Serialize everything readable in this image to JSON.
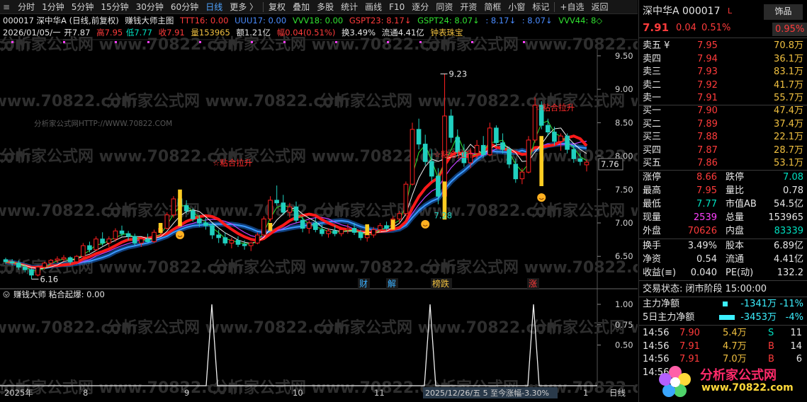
{
  "toolbar": {
    "items": [
      "分时",
      "1分钟",
      "5分钟",
      "15分钟",
      "30分钟",
      "60分钟",
      "日线",
      "更多 〉",
      "复权",
      "叠加",
      "多股",
      "统计",
      "画线",
      "F10",
      "逐分",
      "同资",
      "开资",
      "简框",
      "小窗",
      "标记",
      "+自选",
      "返回"
    ],
    "active_index": 6
  },
  "info1": {
    "stock": "000017  深中华A (日线,前复权)",
    "formula": "赚钱大师主图",
    "ttt": "TTT16: 0.00",
    "uuu": "UUU17: 0.00",
    "vvv18": "VVV18: 0.00",
    "gspt23": "GSPT23: 8.17↓",
    "gspt24": "GSPT24: 8.07↓",
    "v1": ": 8.17↓",
    "v2": ": 8.07↓",
    "vvv44": "VVV44: 8◇"
  },
  "info2": {
    "date": "2026/01/05/一",
    "open": "开7.87",
    "high": "高7.95",
    "low": "低7.77",
    "close": "收7.91",
    "vol": "量153965",
    "amount": "额1.21亿",
    "change": "幅0.04(0.51%)",
    "turnover": "换3.49%",
    "float": "流通4.41亿",
    "sector": "钟表珠宝"
  },
  "watermark": {
    "site": "分析家公式网 www.70822.com",
    "url_small": "分析家公式网HTTP://WWW.70822.COM"
  },
  "chart": {
    "price_ticks": [
      "9.50",
      "9.00",
      "8.50",
      "8.00",
      "7.50",
      "7.00",
      "6.50"
    ],
    "current_price": "7.76",
    "annotations": {
      "peak": "9.23",
      "low1": "6.16",
      "low2": "7.28",
      "signal": "☆粘合拉升"
    },
    "event_tags": [
      "财",
      "解",
      "榜跌",
      "涨"
    ],
    "sub_title": "赚钱大师  粘合起爆: 0.00",
    "sub_ticks": [
      "1.00",
      "0.75",
      "0.50"
    ],
    "x_labels": [
      "2025年",
      "8",
      "9",
      "10",
      "11",
      "1"
    ],
    "cursor_label": "2025/12/26/五 5 至今涨幅-3.30%",
    "period": "日线"
  },
  "chart_data": [
    {
      "type": "candlestick",
      "title": "赚钱大师主图",
      "ylim": [
        6.1,
        9.7
      ],
      "candles": [
        [
          6.45,
          6.48,
          6.38,
          6.42
        ],
        [
          6.42,
          6.46,
          6.36,
          6.4
        ],
        [
          6.4,
          6.44,
          6.3,
          6.34
        ],
        [
          6.34,
          6.38,
          6.26,
          6.3
        ],
        [
          6.3,
          6.33,
          6.16,
          6.22
        ],
        [
          6.22,
          6.36,
          6.2,
          6.34
        ],
        [
          6.34,
          6.42,
          6.3,
          6.4
        ],
        [
          6.4,
          6.46,
          6.36,
          6.44
        ],
        [
          6.44,
          6.5,
          6.4,
          6.46
        ],
        [
          6.46,
          6.52,
          6.42,
          6.48
        ],
        [
          6.48,
          6.5,
          6.38,
          6.42
        ],
        [
          6.42,
          6.52,
          6.4,
          6.5
        ],
        [
          6.5,
          6.7,
          6.48,
          6.66
        ],
        [
          6.66,
          6.72,
          6.56,
          6.6
        ],
        [
          6.6,
          6.8,
          6.58,
          6.76
        ],
        [
          6.76,
          6.86,
          6.66,
          6.7
        ],
        [
          6.7,
          6.8,
          6.64,
          6.76
        ],
        [
          6.76,
          6.92,
          6.72,
          6.88
        ],
        [
          6.88,
          6.96,
          6.8,
          6.84
        ],
        [
          6.84,
          6.88,
          6.74,
          6.8
        ],
        [
          6.8,
          6.84,
          6.66,
          6.7
        ],
        [
          6.7,
          6.78,
          6.64,
          6.76
        ],
        [
          6.76,
          6.84,
          6.7,
          6.72
        ],
        [
          6.72,
          6.9,
          6.7,
          6.86
        ],
        [
          6.86,
          6.98,
          6.8,
          6.92
        ],
        [
          6.92,
          7.16,
          6.9,
          7.12
        ],
        [
          7.12,
          7.4,
          7.08,
          7.36
        ],
        [
          7.36,
          7.46,
          7.2,
          7.26
        ],
        [
          7.26,
          7.34,
          7.14,
          7.18
        ],
        [
          7.18,
          7.22,
          7.02,
          7.06
        ],
        [
          7.06,
          7.12,
          6.94,
          7.0
        ],
        [
          7.0,
          7.08,
          6.9,
          6.96
        ],
        [
          6.96,
          7.0,
          6.76,
          6.82
        ],
        [
          6.82,
          6.9,
          6.7,
          6.78
        ],
        [
          6.78,
          6.86,
          6.66,
          6.7
        ],
        [
          6.7,
          6.78,
          6.62,
          6.74
        ],
        [
          6.74,
          6.8,
          6.64,
          6.68
        ],
        [
          6.68,
          6.74,
          6.6,
          6.66
        ],
        [
          6.66,
          6.72,
          6.58,
          6.7
        ],
        [
          6.7,
          6.86,
          6.68,
          6.82
        ],
        [
          6.82,
          7.1,
          6.8,
          7.06
        ],
        [
          7.06,
          7.4,
          7.02,
          7.34
        ],
        [
          7.34,
          7.56,
          7.26,
          7.3
        ],
        [
          7.3,
          7.42,
          7.12,
          7.16
        ],
        [
          7.16,
          7.3,
          7.08,
          7.24
        ],
        [
          7.24,
          7.32,
          7.0,
          7.04
        ],
        [
          7.04,
          7.1,
          6.86,
          6.92
        ],
        [
          6.92,
          7.04,
          6.84,
          7.0
        ],
        [
          7.0,
          7.08,
          6.86,
          6.9
        ],
        [
          6.9,
          6.98,
          6.8,
          6.84
        ],
        [
          6.84,
          6.92,
          6.78,
          6.88
        ],
        [
          6.88,
          6.96,
          6.8,
          6.84
        ],
        [
          6.84,
          6.94,
          6.8,
          6.9
        ],
        [
          6.9,
          6.98,
          6.84,
          6.92
        ],
        [
          6.92,
          7.0,
          6.82,
          6.86
        ],
        [
          6.86,
          6.9,
          6.74,
          6.78
        ],
        [
          6.78,
          6.86,
          6.72,
          6.82
        ],
        [
          6.82,
          6.94,
          6.78,
          6.9
        ],
        [
          6.9,
          7.0,
          6.86,
          6.96
        ],
        [
          6.96,
          7.02,
          6.88,
          6.92
        ],
        [
          6.92,
          7.1,
          6.9,
          7.06
        ],
        [
          7.06,
          7.18,
          7.0,
          7.14
        ],
        [
          7.14,
          7.62,
          7.1,
          7.58
        ],
        [
          7.58,
          8.5,
          7.56,
          8.4
        ],
        [
          8.4,
          8.56,
          8.1,
          8.18
        ],
        [
          8.18,
          8.32,
          7.86,
          7.92
        ],
        [
          7.92,
          8.1,
          7.62,
          7.7
        ],
        [
          7.7,
          7.82,
          7.28,
          7.4
        ],
        [
          7.4,
          9.23,
          7.38,
          8.6
        ],
        [
          8.6,
          8.7,
          8.2,
          8.28
        ],
        [
          8.28,
          8.4,
          8.0,
          8.06
        ],
        [
          8.06,
          8.18,
          7.84,
          7.9
        ],
        [
          7.9,
          8.12,
          7.82,
          8.04
        ],
        [
          8.04,
          8.24,
          7.96,
          8.16
        ],
        [
          8.16,
          8.3,
          7.98,
          8.02
        ],
        [
          8.02,
          8.5,
          8.0,
          8.42
        ],
        [
          8.42,
          8.46,
          8.14,
          8.2
        ],
        [
          8.2,
          8.34,
          8.04,
          8.1
        ],
        [
          8.1,
          8.14,
          7.82,
          7.88
        ],
        [
          7.88,
          7.96,
          7.6,
          7.66
        ],
        [
          7.66,
          7.82,
          7.58,
          7.76
        ],
        [
          7.76,
          8.3,
          7.74,
          8.24
        ],
        [
          8.24,
          8.88,
          8.2,
          8.76
        ],
        [
          8.76,
          8.82,
          8.4,
          8.46
        ],
        [
          8.46,
          8.56,
          8.3,
          8.36
        ],
        [
          8.36,
          8.44,
          8.16,
          8.22
        ],
        [
          8.22,
          8.34,
          8.08,
          8.3
        ],
        [
          8.3,
          8.34,
          8.04,
          8.1
        ],
        [
          8.1,
          8.16,
          7.9,
          7.96
        ],
        [
          7.96,
          8.04,
          7.86,
          7.92
        ],
        [
          7.87,
          7.95,
          7.77,
          7.91
        ]
      ]
    }
  ],
  "quote": {
    "title": "深中华A  000017",
    "title_mark": "L",
    "badge": "饰品",
    "price": "7.91",
    "change": "0.04",
    "pct": "0.51%",
    "amplitude": "0.95%",
    "asks": [
      {
        "label": "卖五 ¥",
        "price": "7.95",
        "vol": "70.8万"
      },
      {
        "label": "卖四",
        "price": "7.94",
        "vol": "36.1万"
      },
      {
        "label": "卖三",
        "price": "7.93",
        "vol": "83.1万"
      },
      {
        "label": "卖二",
        "price": "7.92",
        "vol": "41.7万"
      },
      {
        "label": "卖一",
        "price": "7.91",
        "vol": "55.7万"
      }
    ],
    "bids": [
      {
        "label": "买一",
        "price": "7.90",
        "vol": "47.4万"
      },
      {
        "label": "买二",
        "price": "7.89",
        "vol": "37.4万"
      },
      {
        "label": "买三",
        "price": "7.88",
        "vol": "22.1万"
      },
      {
        "label": "买四",
        "price": "7.87",
        "vol": "28.7万"
      },
      {
        "label": "买五",
        "price": "7.86",
        "vol": "53.1万"
      }
    ],
    "stats1": [
      [
        "涨停",
        "8.66",
        "跌停",
        "7.08"
      ],
      [
        "最高",
        "7.95",
        "量比",
        "0.78"
      ],
      [
        "最低",
        "7.77",
        "市值AB",
        "54.5亿"
      ],
      [
        "现量",
        "2539",
        "总量",
        "153965"
      ],
      [
        "外盘",
        "70626",
        "内盘",
        "83339"
      ]
    ],
    "stats2": [
      [
        "换手",
        "3.49%",
        "股本",
        "6.89亿"
      ],
      [
        "净资",
        "0.54",
        "流通",
        "4.41亿"
      ],
      [
        "收益(≡)",
        "0.040",
        "PE(动)",
        "132.2"
      ]
    ],
    "trade_status": "交易状态: 闭市阶段 15:00:00",
    "flow": [
      {
        "label": "主力净额",
        "value": "-1341万",
        "pct": "-11%"
      },
      {
        "label": "5日主力净额",
        "value": "-3453万",
        "pct": "-4%"
      }
    ],
    "ticks": [
      [
        "14:56",
        "7.90",
        "5.4万",
        "S",
        "11"
      ],
      [
        "14:56",
        "7.91",
        "4.7万",
        "B",
        "14"
      ],
      [
        "14:56",
        "7.91",
        "7.0万",
        "B",
        "6"
      ],
      [
        "14:56",
        "",
        "",
        "",
        ""
      ]
    ],
    "logo": {
      "name": "分析家公式网",
      "url": "www.70822.com"
    }
  }
}
